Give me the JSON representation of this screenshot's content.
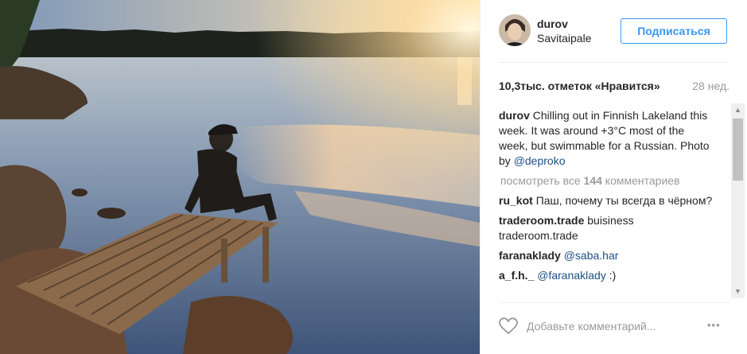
{
  "post": {
    "username": "durov",
    "location": "Savitaipale",
    "follow_label": "Подписаться",
    "likes": "10,3тыс. отметок «Нравится»",
    "age": "28 нед.",
    "caption": {
      "user": "durov",
      "text_before": "Chilling out in Finnish Lakeland this week. It was around +3°C most of the week, but swimmable for a Russian. Photo by ",
      "mention": "@deproko"
    },
    "view_all": {
      "prefix": "посмотреть все ",
      "count": "144",
      "suffix": " комментариев"
    },
    "comments": [
      {
        "user": "ru_kot",
        "text": "Паш, почему ты всегда в чёрном?",
        "mention": ""
      },
      {
        "user": "traderoom.trade",
        "text": "buisiness traderoom.trade",
        "mention": ""
      },
      {
        "user": "faranaklady",
        "text": "",
        "mention": "@saba.har"
      },
      {
        "user": "a_f.h._",
        "text": " :)",
        "mention": "@faranaklady"
      }
    ],
    "add_comment_placeholder": "Добавьте комментарий...",
    "more_icon": "•••"
  },
  "icons": {
    "heart": "heart-icon",
    "more": "more-options-icon",
    "scroll_up": "▲",
    "scroll_down": "▼"
  },
  "colors": {
    "accent": "#3897f0",
    "mention": "#1d4f86",
    "muted": "#999999"
  }
}
